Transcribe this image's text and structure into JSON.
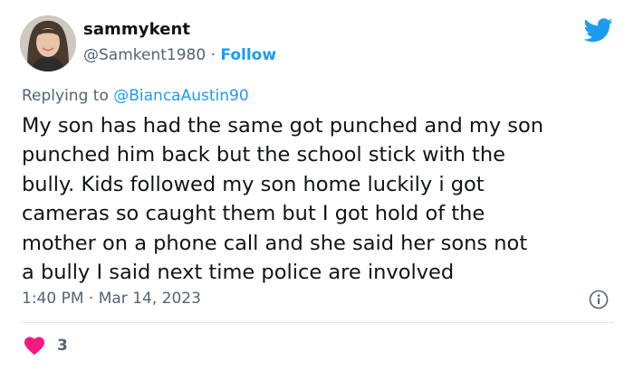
{
  "tweet": {
    "display_name": "sammykent",
    "handle": "@Samkent1980",
    "separator": "·",
    "follow_label": "Follow",
    "replying_prefix": "Replying to",
    "replying_to": "@BiancaAustin90",
    "text": "My son has had the same got punched and my son\npunched him back but the school stick with the\nbully. Kids followed my son home luckily i got\ncameras so caught them but I got hold of the\nmother on a phone call and she said her sons not\na bully I said next time police are involved",
    "time": "1:40 PM",
    "date_separator": "·",
    "date": "Mar 14, 2023",
    "like_count": "3"
  },
  "icons": {
    "brand": "twitter-bird-icon",
    "info": "info-icon",
    "like": "heart-icon"
  },
  "colors": {
    "accent": "#1d9bf0",
    "secondary_text": "#536471",
    "like": "#f91880"
  }
}
